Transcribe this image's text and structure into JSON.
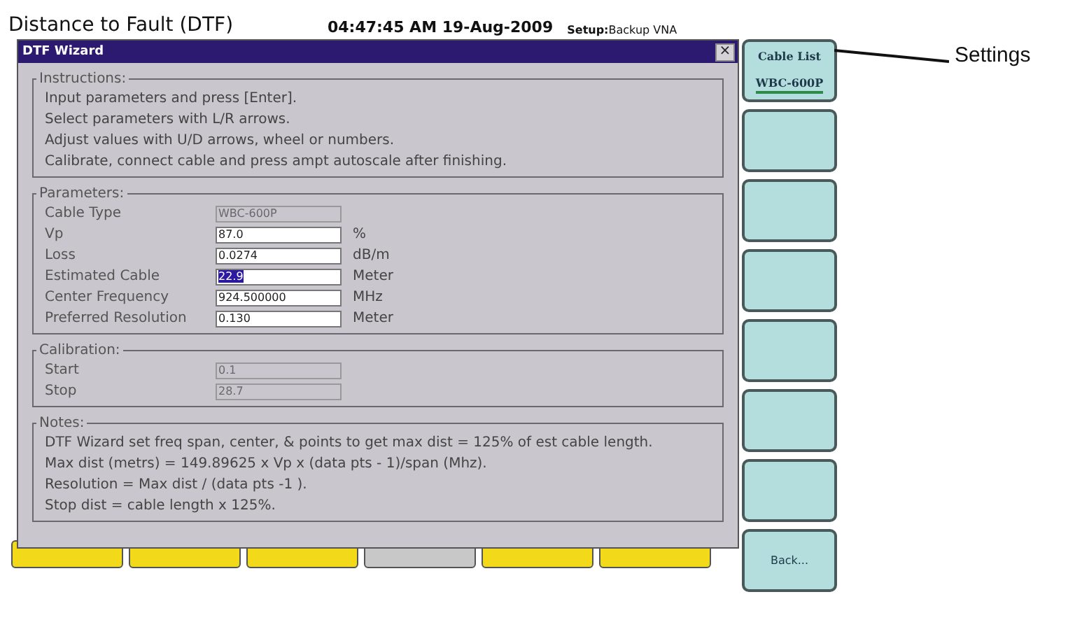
{
  "header": {
    "title": "Distance to Fault (DTF)",
    "datetime": "04:47:45 AM 19-Aug-2009",
    "setup_label": "Setup:",
    "setup_value": "Backup VNA"
  },
  "dialog": {
    "title": "DTF Wizard",
    "close": "×",
    "instructions": {
      "legend": "Instructions:",
      "lines": [
        "Input parameters and press [Enter].",
        "Select parameters with L/R arrows.",
        "Adjust values with U/D arrows, wheel or numbers.",
        "Calibrate, connect cable and press ampt autoscale after finishing."
      ]
    },
    "parameters": {
      "legend": "Parameters:",
      "rows": [
        {
          "label": "Cable Type",
          "value": "WBC-600P",
          "disabled": true,
          "selected": false
        },
        {
          "label": "Vp",
          "value": "87.0",
          "unit": "%",
          "disabled": false,
          "selected": false
        },
        {
          "label": "Loss",
          "value": "0.0274",
          "unit": "dB/m",
          "disabled": false,
          "selected": false
        },
        {
          "label": "Estimated Cable",
          "value": "22.9",
          "unit": "Meter",
          "disabled": false,
          "selected": true
        },
        {
          "label": "Center Frequency",
          "value": "924.500000",
          "unit": "MHz",
          "disabled": false,
          "selected": false
        },
        {
          "label": "Preferred Resolution",
          "value": "0.130",
          "unit": "Meter",
          "disabled": false,
          "selected": false
        }
      ]
    },
    "calibration": {
      "legend": "Calibration:",
      "rows": [
        {
          "label": "Start",
          "value": "0.1",
          "disabled": true,
          "selected": false
        },
        {
          "label": "Stop",
          "value": "28.7",
          "disabled": true,
          "selected": false
        }
      ]
    },
    "notes": {
      "legend": "Notes:",
      "lines": [
        "DTF Wizard set freq span, center, & points to get max dist = 125% of est cable length.",
        "Max dist (metrs) = 149.89625 x Vp x (data pts - 1)/span (Mhz).",
        "Resolution = Max dist / (data pts -1 ).",
        "Stop dist = cable length x 125%."
      ]
    }
  },
  "bottom_tabs": [
    {
      "selected": false
    },
    {
      "selected": false
    },
    {
      "selected": false
    },
    {
      "selected": true
    },
    {
      "selected": false
    },
    {
      "selected": false
    }
  ],
  "softkeys": [
    {
      "kind": "setting",
      "label": "Cable List",
      "value": "WBC-600P"
    },
    {
      "kind": "blank"
    },
    {
      "kind": "blank"
    },
    {
      "kind": "blank"
    },
    {
      "kind": "blank"
    },
    {
      "kind": "blank"
    },
    {
      "kind": "blank"
    },
    {
      "kind": "action",
      "label": "Back..."
    }
  ],
  "annotation": {
    "label": "Settings"
  }
}
